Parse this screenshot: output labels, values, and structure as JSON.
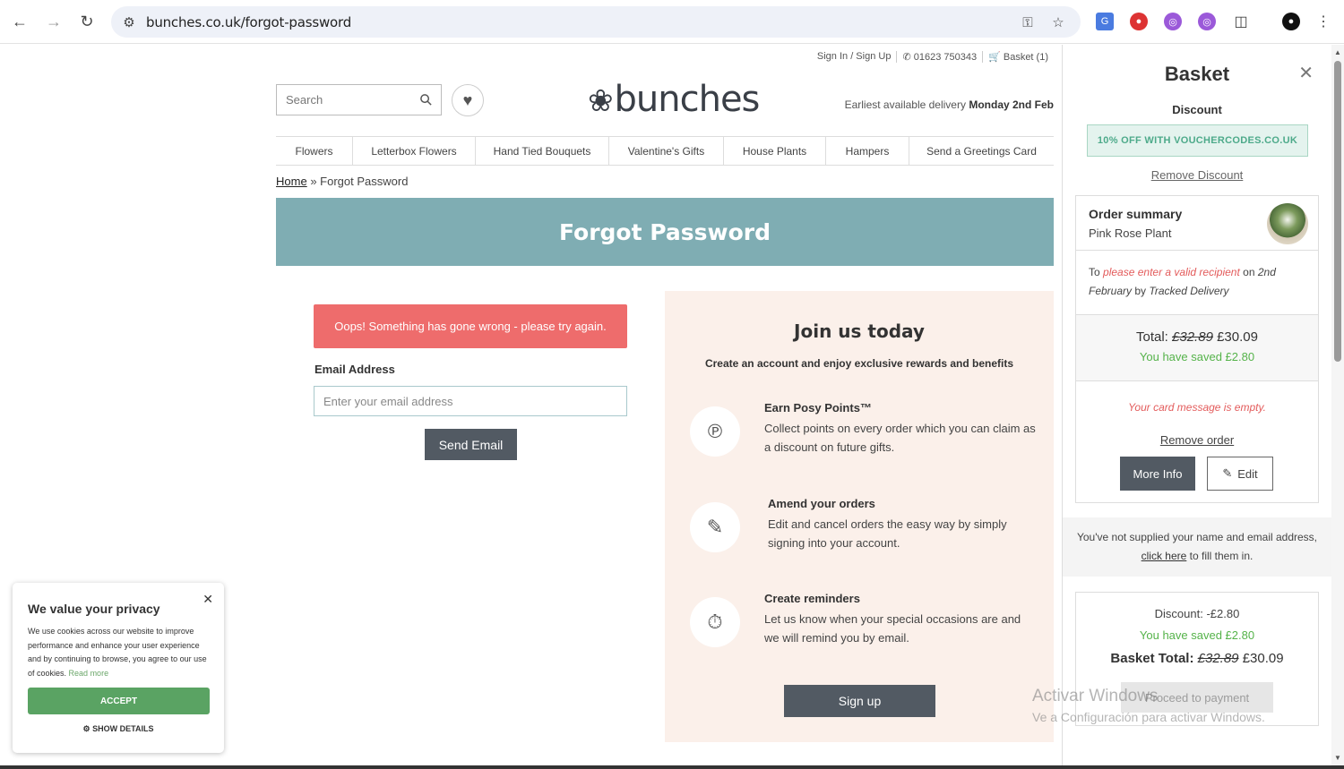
{
  "browser": {
    "url": "bunches.co.uk/forgot-password"
  },
  "header": {
    "sign_in": "Sign In / Sign Up",
    "phone": "01623 750343",
    "basket": "Basket (1)",
    "search_placeholder": "Search",
    "logo": "bunches",
    "delivery_prefix": "Earliest available delivery",
    "delivery_date": "Monday 2nd Feb"
  },
  "menu": [
    "Flowers",
    "Letterbox Flowers",
    "Hand Tied Bouquets",
    "Valentine's Gifts",
    "House Plants",
    "Hampers",
    "Send a Greetings Card"
  ],
  "breadcrumb": {
    "home": "Home",
    "sep": "»",
    "current": "Forgot Password"
  },
  "page": {
    "title": "Forgot Password",
    "error": "Oops! Something has gone wrong - please try again.",
    "email_label": "Email Address",
    "email_placeholder": "Enter your email address",
    "send_button": "Send Email"
  },
  "join": {
    "title": "Join us today",
    "subtitle": "Create an account and enjoy exclusive rewards and benefits",
    "benefits": [
      {
        "title": "Earn Posy Points™",
        "desc": "Collect points on every order which you can claim as a discount on future gifts.",
        "icon": "posy-points-icon"
      },
      {
        "title": "Amend your orders",
        "desc": "Edit and cancel orders the easy way by simply signing into your account.",
        "icon": "edit-order-icon"
      },
      {
        "title": "Create reminders",
        "desc": "Let us know when your special occasions are and we will remind you by email.",
        "icon": "stopwatch-icon"
      }
    ],
    "signup_button": "Sign up"
  },
  "basket": {
    "title": "Basket",
    "discount_label": "Discount",
    "voucher": "10% OFF WITH VOUCHERCODES.CO.UK",
    "remove_discount": "Remove Discount",
    "summary_title": "Order summary",
    "product": "Pink Rose Plant",
    "to": "To",
    "recipient_warning": "please enter a valid recipient",
    "on": "on",
    "date": "2nd February",
    "by": "by",
    "delivery_method": "Tracked Delivery",
    "total_label": "Total:",
    "old_price": "£32.89",
    "new_price": "£30.09",
    "saved": "You have saved £2.80",
    "card_message": "Your card message is empty.",
    "remove_order": "Remove order",
    "more_info": "More Info",
    "edit": "Edit",
    "supply_text": "You've not supplied your name and email address,",
    "click_here": "click here",
    "supply_text2": "to fill them in.",
    "discount_line": "Discount: -£2.80",
    "basket_total_label": "Basket Total:",
    "proceed": "Proceed to payment"
  },
  "cookie": {
    "title": "We value your privacy",
    "text": "We use cookies across our website to improve performance and enhance your user experience and by continuing to browse, you agree to our use of cookies.",
    "read_more": "Read more",
    "accept": "ACCEPT",
    "show_details": "SHOW DETAILS"
  },
  "watermark": {
    "line1": "Activar Windows",
    "line2": "Ve a Configuración para activar Windows."
  },
  "colors": {
    "banner": "#7fadb3",
    "error": "#ee6c6c",
    "button_dark": "#525a63",
    "accept_green": "#5aa363",
    "saved_green": "#55b34a",
    "join_bg": "#fbf0ea"
  }
}
